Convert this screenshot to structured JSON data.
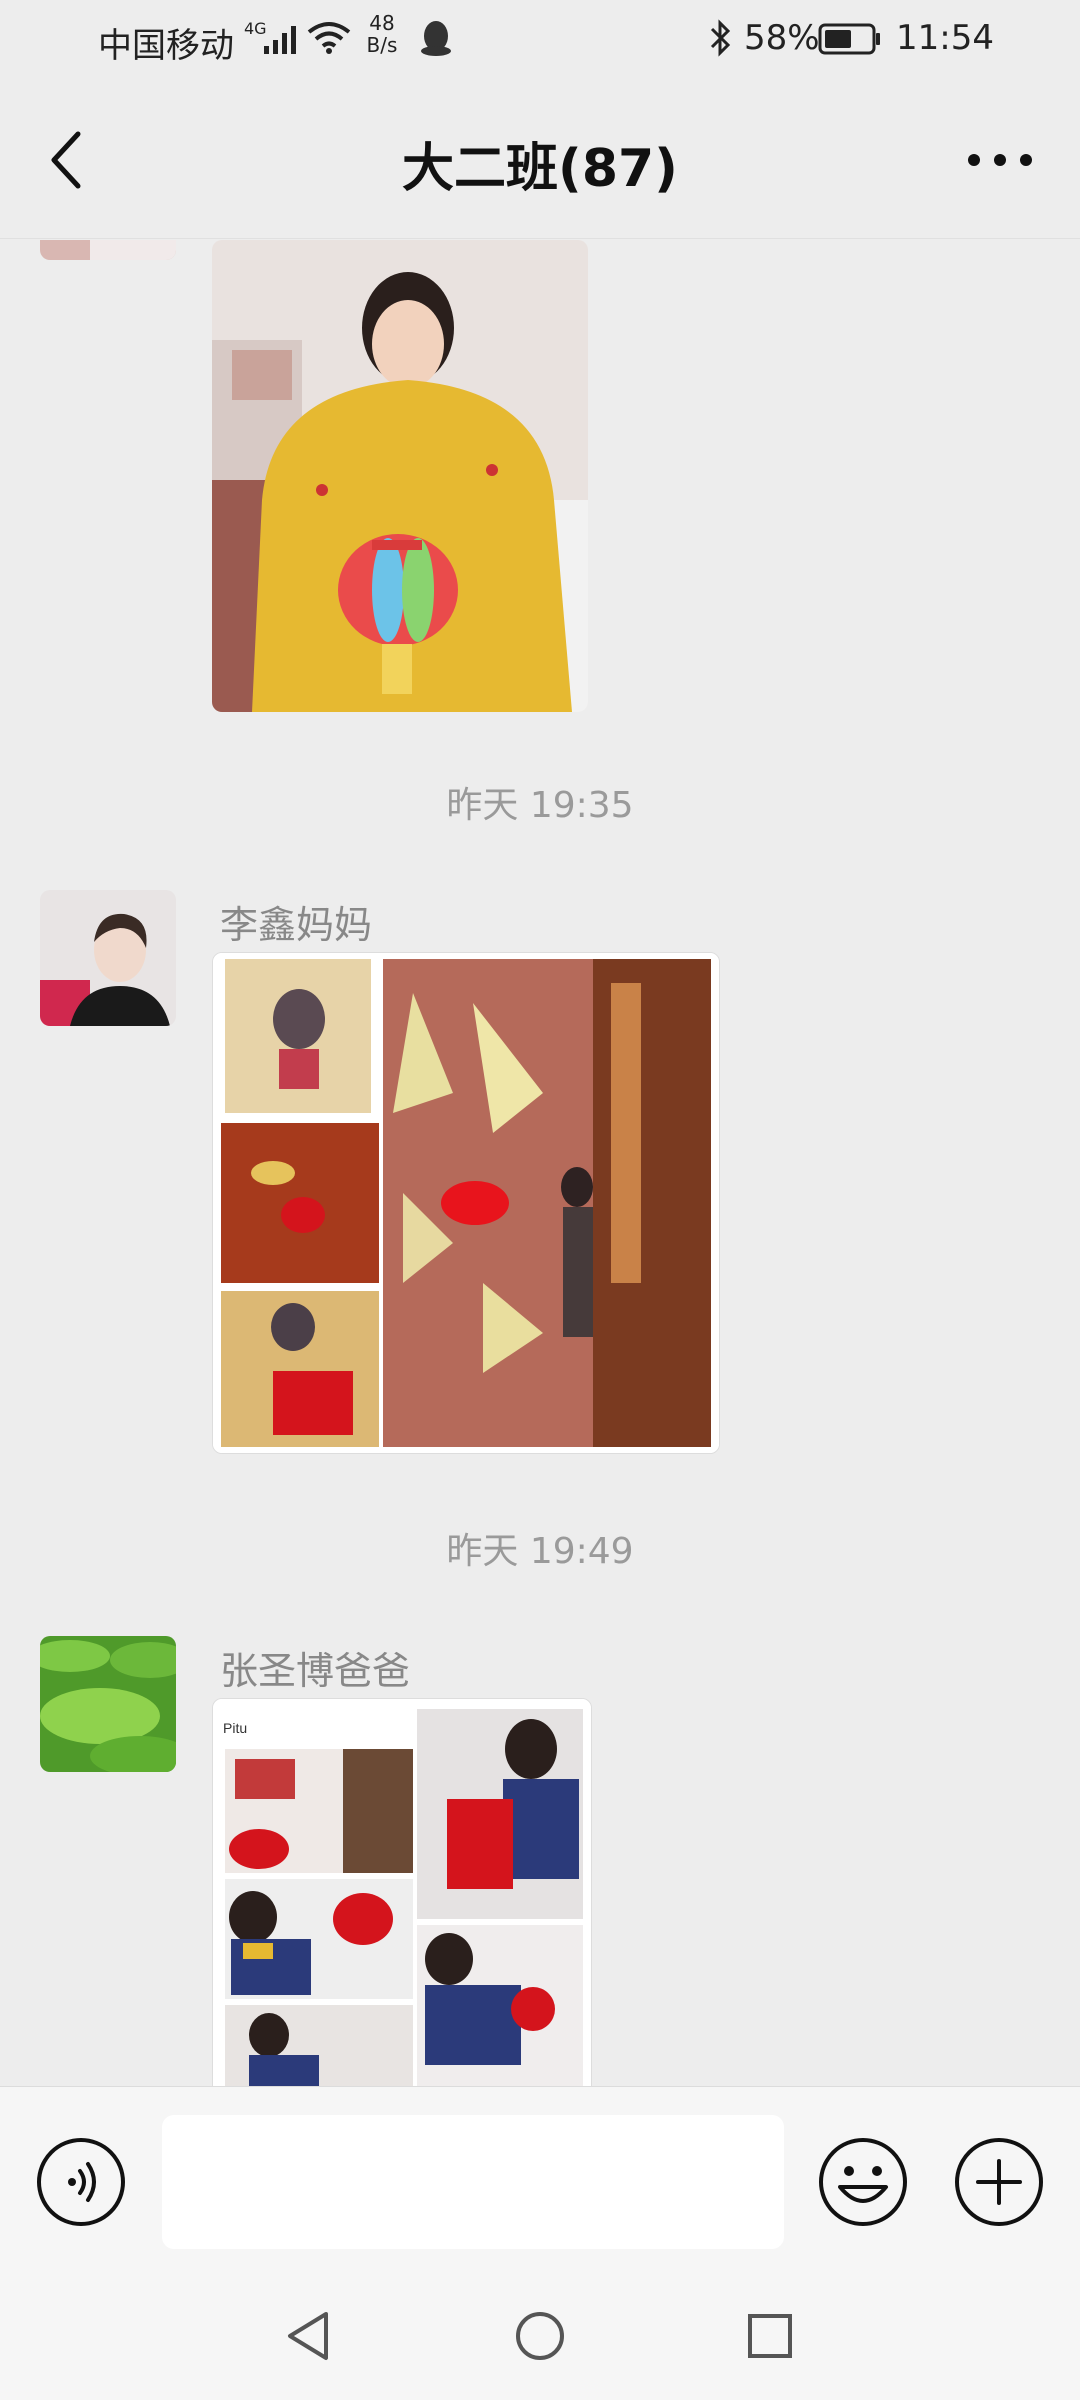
{
  "status_bar": {
    "carrier": "中国移动",
    "network": "4G",
    "net_speed_value": "48",
    "net_speed_unit": "B/s",
    "battery": "58%",
    "time": "11:54"
  },
  "header": {
    "title": "大二班(87)"
  },
  "messages": [
    {
      "sender": "",
      "type": "image",
      "image_desc": "girl-with-paper-lantern"
    },
    {
      "time": "昨天 19:35"
    },
    {
      "sender": "李鑫妈妈",
      "type": "image",
      "image_desc": "lantern-collage"
    },
    {
      "time": "昨天 19:49"
    },
    {
      "sender": "张圣博爸爸",
      "type": "image",
      "image_desc": "boy-lantern-collage",
      "watermark": "Pitu"
    }
  ],
  "icons": {
    "back": "chevron-left-icon",
    "more": "more-dots-icon",
    "voice": "voice-icon",
    "emoji": "emoji-icon",
    "plus": "plus-icon"
  },
  "colors": {
    "background": "#ededed",
    "input_bar": "#f6f6f6",
    "lantern_red": "#d4141c"
  }
}
